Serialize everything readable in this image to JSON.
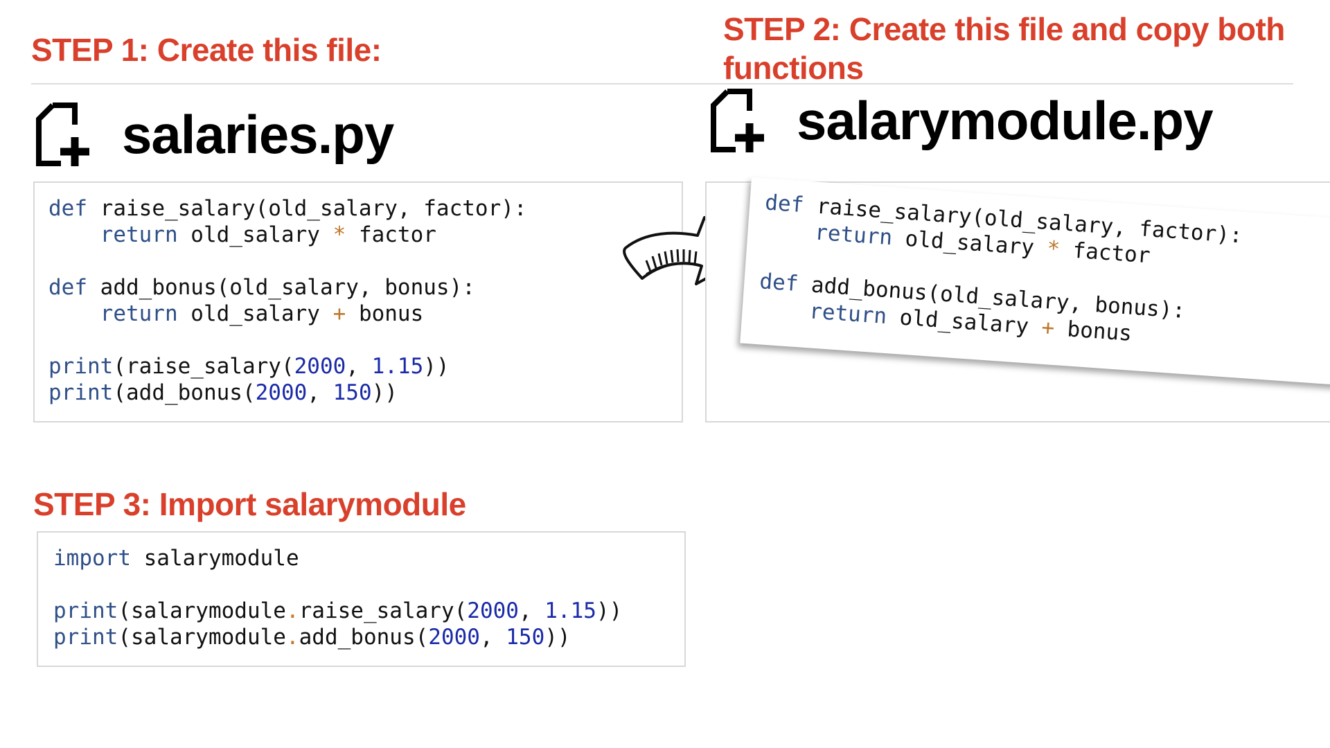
{
  "steps": {
    "step1": "STEP 1: Create this file:",
    "step2": "STEP 2: Create this file and copy both functions",
    "step3": "STEP 3: Import salarymodule"
  },
  "files": {
    "file1": "salaries.py",
    "file2": "salarymodule.py"
  },
  "code": {
    "def": "def",
    "return": "return",
    "print": "print",
    "import": "import",
    "raise_sig": " raise_salary(old_salary, factor):",
    "raise_body_a": " old_salary ",
    "mul": "*",
    "raise_body_b": " factor",
    "bonus_sig": " add_bonus(old_salary, bonus):",
    "bonus_body_a": " old_salary ",
    "plus": "+",
    "bonus_body_b": " bonus",
    "call_raise": "(raise_salary(",
    "call_bonus": "(add_bonus(",
    "n2000": "2000",
    "n115": "1.15",
    "n150": "150",
    "comma": ", ",
    "close": "))",
    "import_target": " salarymodule",
    "mod_prefix": "(salarymodule",
    "dot": ".",
    "mod_raise": "raise_salary(",
    "mod_bonus": "add_bonus("
  },
  "icons": {
    "file_add": "file-add-icon",
    "arrow": "curved-arrow-icon"
  },
  "colors": {
    "step_title": "#d9402b",
    "keyword": "#2e4f87",
    "number": "#1a2aa8",
    "operator": "#c0782b"
  }
}
